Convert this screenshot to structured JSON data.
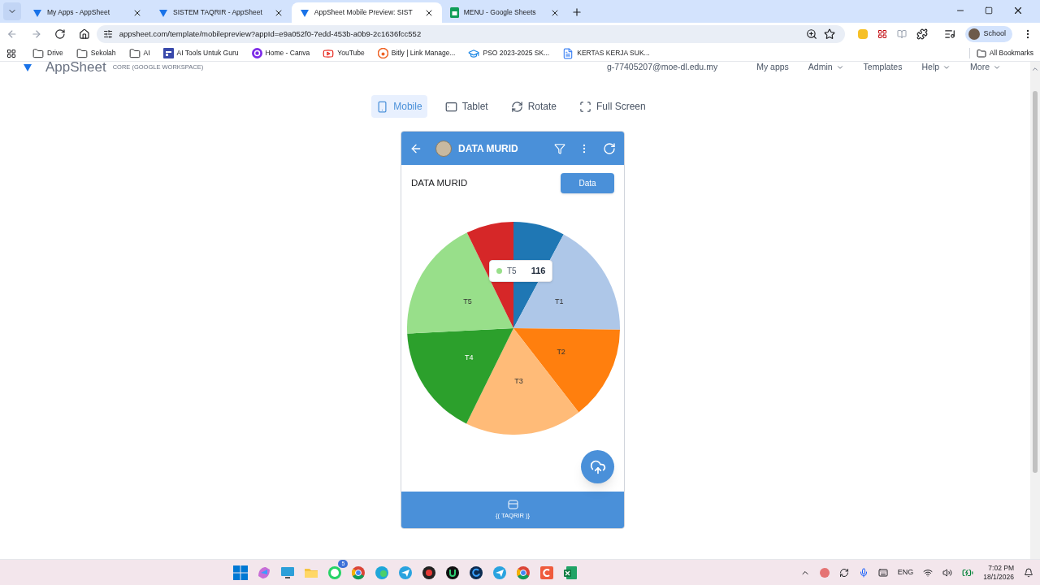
{
  "browser": {
    "tabs": [
      {
        "title": "My Apps - AppSheet",
        "kind": "appsheet",
        "selected": false
      },
      {
        "title": "SISTEM TAQRIR - AppSheet",
        "kind": "appsheet",
        "selected": false
      },
      {
        "title": "AppSheet Mobile Preview: SIST",
        "kind": "appsheet",
        "selected": true
      },
      {
        "title": "MENU - Google Sheets",
        "kind": "sheets",
        "selected": false
      }
    ],
    "url": "appsheet.com/template/mobilepreview?appId=e9a052f0-7edd-453b-a0b9-2c1636fcc552",
    "profile": "School",
    "bookmarks": [
      {
        "label": "Drive",
        "kind": "folder"
      },
      {
        "label": "Sekolah",
        "kind": "folder"
      },
      {
        "label": "AI",
        "kind": "folder"
      },
      {
        "label": "AI Tools Untuk Guru",
        "kind": "app"
      },
      {
        "label": "Home - Canva",
        "kind": "canva"
      },
      {
        "label": "YouTube",
        "kind": "youtube"
      },
      {
        "label": "Bitly | Link Manage...",
        "kind": "bitly"
      },
      {
        "label": "PSO 2023-2025 SK...",
        "kind": "cap"
      },
      {
        "label": "KERTAS KERJA SUK...",
        "kind": "doc"
      }
    ],
    "all_bookmarks": "All Bookmarks"
  },
  "header": {
    "brand": "AppSheet",
    "edition": "CORE (GOOGLE WORKSPACE)",
    "email": "g-77405207@moe-dl.edu.my",
    "nav": [
      {
        "label": "My apps",
        "dropdown": false
      },
      {
        "label": "Admin",
        "dropdown": true
      },
      {
        "label": "Templates",
        "dropdown": false
      },
      {
        "label": "Help",
        "dropdown": true
      },
      {
        "label": "More",
        "dropdown": true
      }
    ]
  },
  "preview_modes": [
    {
      "label": "Mobile",
      "kind": "mobile",
      "selected": true
    },
    {
      "label": "Tablet",
      "kind": "tablet",
      "selected": false
    },
    {
      "label": "Rotate",
      "kind": "rotate",
      "selected": false
    },
    {
      "label": "Full Screen",
      "kind": "fullscreen",
      "selected": false
    }
  ],
  "app": {
    "title": "DATA MURID",
    "view_title": "DATA MURID",
    "data_button": "Data",
    "chart_data": {
      "type": "pie",
      "categories": [
        null,
        "T1",
        "T2",
        "T3",
        "T4",
        "T5",
        null
      ],
      "values": [
        7.8,
        17.4,
        14.3,
        17.8,
        16.9,
        18.6,
        7.2
      ],
      "colors": [
        "#1f77b4",
        "#aec7e8",
        "#ff7f0e",
        "#ffbb78",
        "#2ca02c",
        "#98df8a",
        "#d62728"
      ]
    },
    "tooltip": {
      "label": "T5",
      "value": "116",
      "color": "#98df8a"
    },
    "bottom_nav": [
      {
        "label": "{( TAQRIR )}"
      }
    ]
  },
  "taskbar": {
    "apps": [
      {
        "kind": "windows"
      },
      {
        "kind": "copilot"
      },
      {
        "kind": "desktop"
      },
      {
        "kind": "files"
      },
      {
        "kind": "whatsapp",
        "badge": "5"
      },
      {
        "kind": "chrome"
      },
      {
        "kind": "edge"
      },
      {
        "kind": "telegram"
      },
      {
        "kind": "red"
      },
      {
        "kind": "u"
      },
      {
        "kind": "g"
      },
      {
        "kind": "telegram"
      },
      {
        "kind": "chrome"
      },
      {
        "kind": "c"
      },
      {
        "kind": "excel"
      }
    ],
    "language": "ENG",
    "time": "7:02 PM",
    "date": "18/1/2026"
  }
}
